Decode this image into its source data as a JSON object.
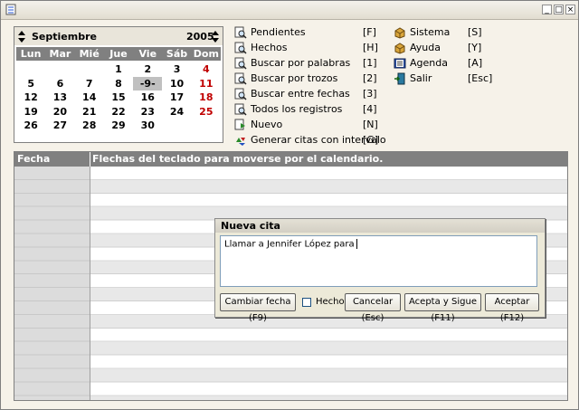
{
  "window": {
    "buttons": [
      "_",
      "□",
      "×"
    ]
  },
  "calendar": {
    "month": "Septiembre",
    "year": "2005",
    "days_of_week": [
      "Lun",
      "Mar",
      "Mié",
      "Jue",
      "Vie",
      "Sáb",
      "Dom"
    ],
    "weeks": [
      [
        "",
        "",
        "",
        "1",
        "2",
        "3",
        "4"
      ],
      [
        "5",
        "6",
        "7",
        "8",
        "-9-",
        "10",
        "11"
      ],
      [
        "12",
        "13",
        "14",
        "15",
        "16",
        "17",
        "18"
      ],
      [
        "19",
        "20",
        "21",
        "22",
        "23",
        "24",
        "25"
      ],
      [
        "26",
        "27",
        "28",
        "29",
        "30",
        "",
        ""
      ]
    ],
    "selected": "-9-",
    "sunday_color": "#c00000"
  },
  "menu_left": [
    {
      "label": "Pendientes",
      "key": "[F]",
      "icon": "search-doc-icon"
    },
    {
      "label": "Hechos",
      "key": "[H]",
      "icon": "search-doc-icon"
    },
    {
      "label": "Buscar por palabras",
      "key": "[1]",
      "icon": "search-doc-icon"
    },
    {
      "label": "Buscar por trozos",
      "key": "[2]",
      "icon": "search-doc-icon"
    },
    {
      "label": "Buscar entre fechas",
      "key": "[3]",
      "icon": "search-doc-icon"
    },
    {
      "label": "Todos los registros",
      "key": "[4]",
      "icon": "search-doc-icon"
    },
    {
      "label": "Nuevo",
      "key": "[N]",
      "icon": "new-doc-icon"
    },
    {
      "label": "Generar citas con intervalo",
      "key": "[G]",
      "icon": "recycle-icon"
    }
  ],
  "menu_right": [
    {
      "label": "Sistema",
      "key": "[S]",
      "icon": "box-icon"
    },
    {
      "label": "Ayuda",
      "key": "[Y]",
      "icon": "box-icon"
    },
    {
      "label": "Agenda",
      "key": "[A]",
      "icon": "book-icon"
    },
    {
      "label": "Salir",
      "key": "[Esc]",
      "icon": "exit-door-icon"
    }
  ],
  "table": {
    "col_fecha": "Fecha",
    "col_message": "Flechas del teclado para moverse por el calendario."
  },
  "dialog": {
    "title": "Nueva cita",
    "text": "Llamar a Jennifer López para",
    "buttons": {
      "change_date": "Cambiar fecha (F9)",
      "done_label": "Hecho",
      "cancel": "Cancelar (Esc)",
      "accept_continue": "Acepta y Sigue (F11)",
      "accept": "Aceptar (F12)"
    }
  }
}
